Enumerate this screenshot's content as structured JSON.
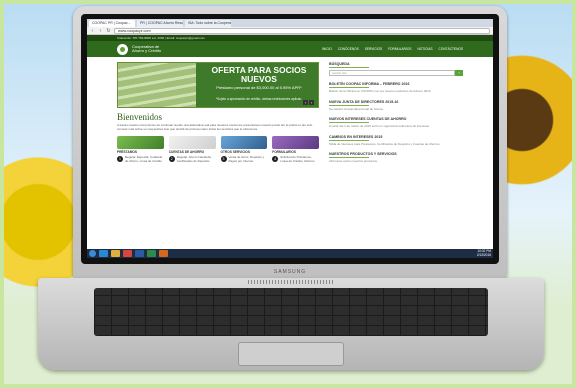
{
  "browser": {
    "tabs": [
      "COOPAC PR | Coopac...",
      "PR | COOPAC Ahorro Resum...",
      "ISA: Todo sobre la Cooperativ..."
    ],
    "url": "www.coopacpr.com"
  },
  "site": {
    "contact": "Cidoverde: 787-752-8600 ext. 2000 | Email: coopacpr@gmail.com",
    "logo_text": "Cooperativa de Ahorro y Crédito",
    "nav": [
      "INICIO",
      "CONÓCENOS",
      "SERVICIOS",
      "FORMULARIOS",
      "NOTICIAS",
      "CONTÁCTENOS"
    ],
    "banner": {
      "title": "OFERTA PARA SOCIOS NUEVOS",
      "subtitle": "Préstamo personal de $3,000.00 al 5.95% APR*",
      "note": "*Sujeto a aprobación de crédito, ciertas restricciones aplican."
    },
    "welcome_title": "Bienvenidos",
    "welcome_text": "A través nuestro compromiso de continuar siendo una alternativa real para nuestros socios les presentamos nuestro portal. En él podrá no tan solo conocer más sobre su cooperativa sino que tendrá de primera mano todos los servicios que le ofrecemos.",
    "services": [
      {
        "title": "PRÉSTAMOS",
        "num": "1",
        "desc": "Regular, Especial, Colateral de Ahorro, Línea de Crédito"
      },
      {
        "title": "CUENTAS DE AHORRO",
        "num": "2",
        "desc": "Regular, Ahorro Navideño, Certificados de Depósito"
      },
      {
        "title": "OTROS SERVICIOS",
        "num": "3",
        "desc": "Venta de Giros, Depósito y Pagos por Internet"
      },
      {
        "title": "FORMULARIOS",
        "num": "4",
        "desc": "Solicitud de Préstamos, Línea de Crédito, Ahorros"
      }
    ],
    "sidebar": {
      "search_title": "BÚSQUEDA",
      "search_placeholder": "search site",
      "blocks": [
        {
          "title": "BOLETÍN COOPAC INFORMA – FEBRERO 2016",
          "text": "Boletín de la Oficina en COOPAC con los nuevos productos de febrero 2016"
        },
        {
          "title": "NUEVA JUNTA DE DIRECTORES 2015-16",
          "text": "Se celebró la Asamblea Anual de Socios."
        },
        {
          "title": "NUEVOS INTERESES CUENTAS DE AHORRO",
          "text": "A partir del 1 de marzo de 2015 entró en vigencia la estructura de intereses."
        },
        {
          "title": "CAMBIOS EN INTERESES 2015",
          "text": "Tabla de intereses para Préstamos, Certificados de Depósito y Cuentas de Ahorros."
        },
        {
          "title": "NUESTROS PRODUCTOS Y SERVICIOS",
          "text": "Infórmese sobre nuestros productos."
        }
      ]
    },
    "taskbar_time": "10:02 PM",
    "taskbar_date": "2/13/2016"
  },
  "laptop": {
    "brand": "SAMSUNG"
  }
}
